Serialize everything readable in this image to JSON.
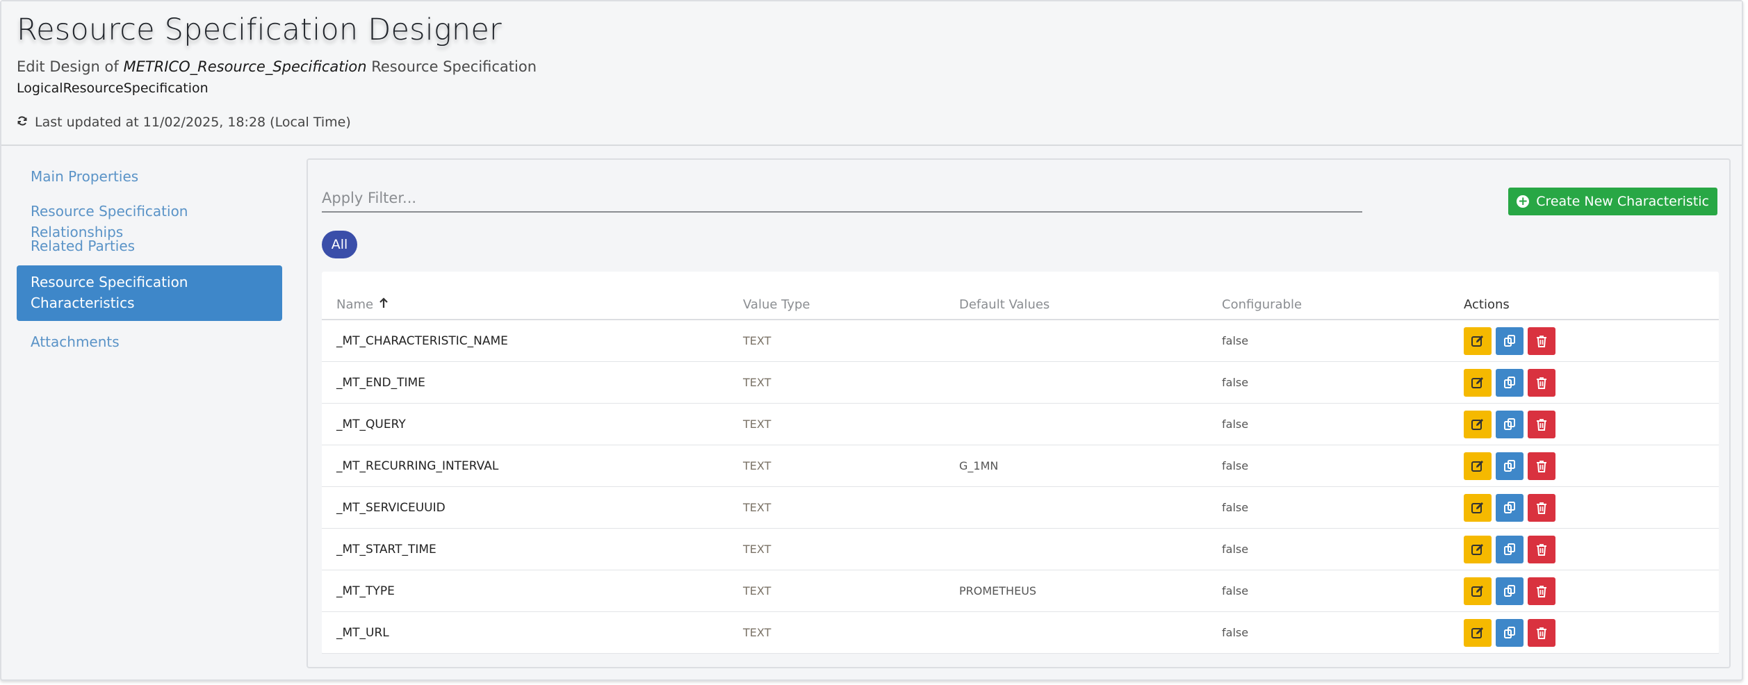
{
  "header": {
    "title": "Resource Specification Designer",
    "subtitle_prefix": "Edit Design of",
    "spec_name": "METRICO_Resource_Specification",
    "subtitle_suffix": "Resource Specification",
    "spec_type": "LogicalResourceSpecification",
    "last_updated": "Last updated at 11/02/2025, 18:28 (Local Time)"
  },
  "sidebar": {
    "items": [
      {
        "label": "Main Properties",
        "active": false
      },
      {
        "label": "Resource Specification Relationships",
        "active": false
      },
      {
        "label": "Related Parties",
        "active": false
      },
      {
        "label": "Resource Specification Characteristics",
        "active": true
      },
      {
        "label": "Attachments",
        "active": false
      }
    ]
  },
  "panel": {
    "filter_placeholder": "Apply Filter...",
    "create_label": "Create New Characteristic",
    "filter_pill": "All",
    "columns": [
      "Name",
      "Value Type",
      "Default Values",
      "Configurable",
      "Actions"
    ],
    "rows": [
      {
        "name": "_MT_CHARACTERISTIC_NAME",
        "type": "TEXT",
        "default": "",
        "configurable": "false"
      },
      {
        "name": "_MT_END_TIME",
        "type": "TEXT",
        "default": "",
        "configurable": "false"
      },
      {
        "name": "_MT_QUERY",
        "type": "TEXT",
        "default": "",
        "configurable": "false"
      },
      {
        "name": "_MT_RECURRING_INTERVAL",
        "type": "TEXT",
        "default": "G_1MN",
        "configurable": "false"
      },
      {
        "name": "_MT_SERVICEUUID",
        "type": "TEXT",
        "default": "",
        "configurable": "false"
      },
      {
        "name": "_MT_START_TIME",
        "type": "TEXT",
        "default": "",
        "configurable": "false"
      },
      {
        "name": "_MT_TYPE",
        "type": "TEXT",
        "default": "PROMETHEUS",
        "configurable": "false"
      },
      {
        "name": "_MT_URL",
        "type": "TEXT",
        "default": "",
        "configurable": "false"
      }
    ]
  },
  "colors": {
    "accent": "#3e87c9",
    "create": "#28a745",
    "pill": "#3a4ea9",
    "edit": "#f5b900",
    "delete": "#d9323f"
  },
  "icons": [
    "refresh-icon",
    "plus-circle-icon",
    "arrow-up-icon",
    "edit-icon",
    "copy-icon",
    "trash-icon"
  ]
}
